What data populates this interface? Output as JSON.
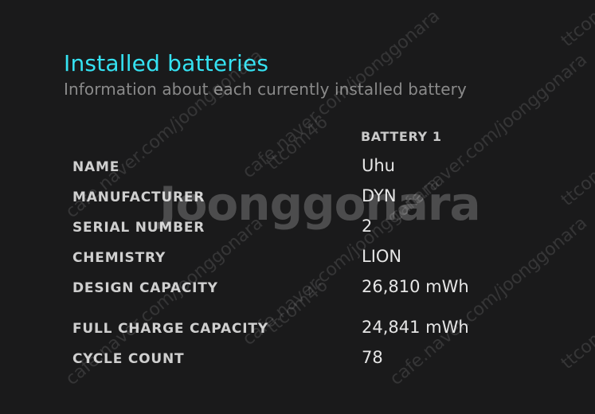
{
  "section": {
    "title": "Installed batteries",
    "subtitle": "Information about each currently installed battery"
  },
  "battery": {
    "column_header": "BATTERY 1"
  },
  "rows": [
    {
      "label": "NAME",
      "value": "Uhu"
    },
    {
      "label": "MANUFACTURER",
      "value": "DYN"
    },
    {
      "label": "SERIAL NUMBER",
      "value": "2"
    },
    {
      "label": "CHEMISTRY",
      "value": "LION"
    },
    {
      "label": "DESIGN CAPACITY",
      "value": "26,810 mWh"
    },
    {
      "label": "FULL CHARGE CAPACITY",
      "value": "24,841 mWh"
    },
    {
      "label": "CYCLE COUNT",
      "value": "78"
    }
  ],
  "watermarks": {
    "logo": "Joonggonara",
    "site": "cafe.naver.com/joonggonara",
    "tag": "ttcom46",
    "tag2": "ttcom"
  },
  "colors": {
    "background": "#1a1a1b",
    "title": "#35e2f2",
    "subtitle": "#8a8a8a",
    "label": "#cfcfcf",
    "value": "#e6e6e6"
  }
}
